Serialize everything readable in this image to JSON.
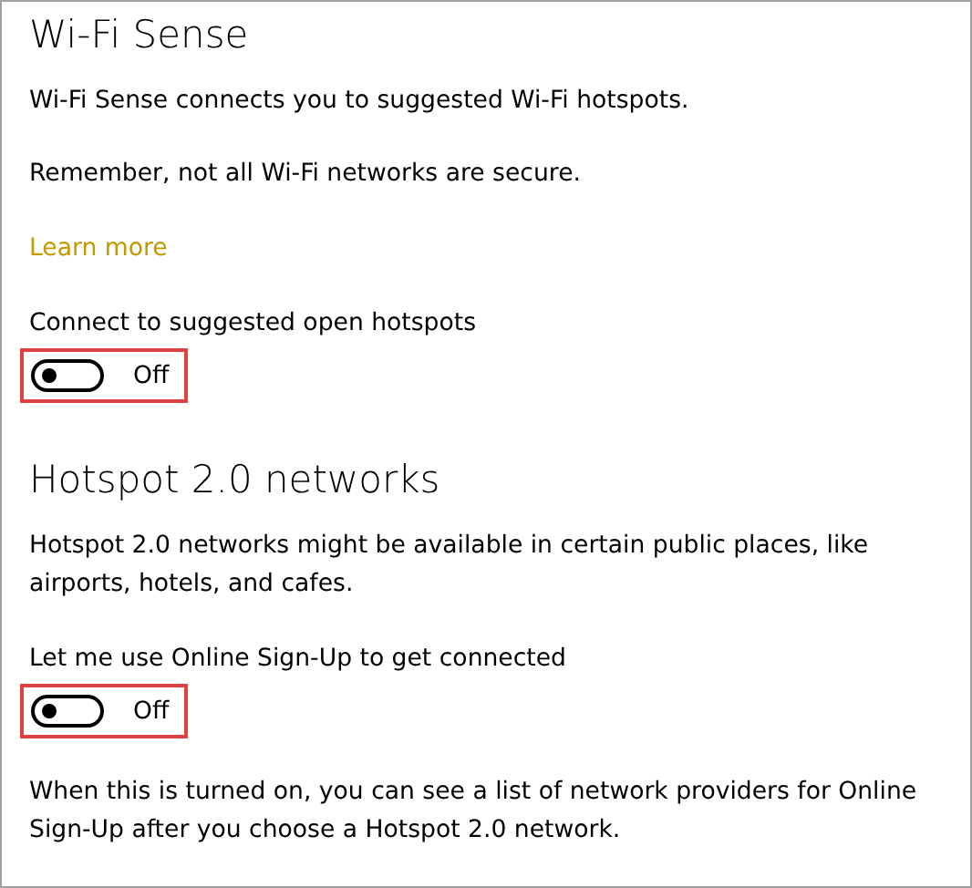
{
  "sections": [
    {
      "title": "Wi-Fi Sense",
      "items": [
        {
          "kind": "text",
          "text": "Wi-Fi Sense connects you to suggested Wi-Fi hotspots."
        },
        {
          "kind": "text",
          "text": "Remember, not all Wi-Fi networks are secure."
        },
        {
          "kind": "link",
          "text": "Learn more"
        },
        {
          "kind": "toggle",
          "label": "Connect to suggested open hotspots",
          "on": false,
          "state_text": "Off",
          "highlighted": true
        }
      ]
    },
    {
      "title": "Hotspot 2.0 networks",
      "items": [
        {
          "kind": "text",
          "text": "Hotspot 2.0 networks might be available in certain public places, like airports, hotels, and cafes."
        },
        {
          "kind": "toggle",
          "label": "Let me use Online Sign-Up to get connected",
          "on": false,
          "state_text": "Off",
          "highlighted": true
        },
        {
          "kind": "text",
          "text": "When this is turned on, you can see a list of network providers for Online Sign-Up after you choose a Hotspot 2.0 network."
        }
      ]
    }
  ]
}
